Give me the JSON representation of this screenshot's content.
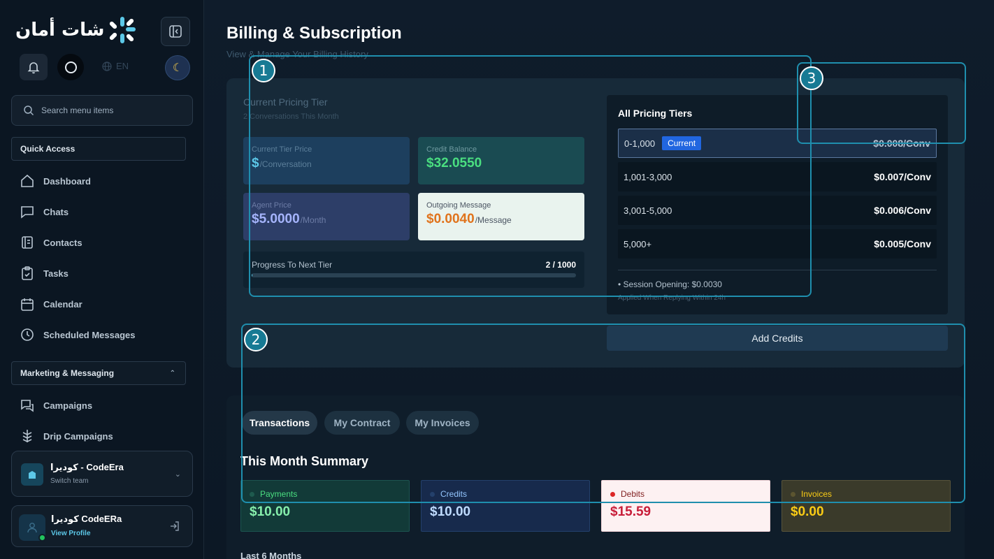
{
  "app": {
    "logo_text": "شات أمان",
    "language": "EN"
  },
  "sidebar": {
    "search_placeholder": "Search menu items",
    "quick_access": "Quick Access",
    "items": [
      {
        "label": "Dashboard",
        "icon": "home-icon"
      },
      {
        "label": "Chats",
        "icon": "chat-icon"
      },
      {
        "label": "Contacts",
        "icon": "contacts-icon"
      },
      {
        "label": "Tasks",
        "icon": "clipboard-icon"
      },
      {
        "label": "Calendar",
        "icon": "calendar-icon"
      },
      {
        "label": "Scheduled Messages",
        "icon": "clock-icon"
      }
    ],
    "marketing_section": "Marketing & Messaging",
    "marketing_items": [
      {
        "label": "Campaigns",
        "icon": "campaigns-icon"
      },
      {
        "label": "Drip Campaigns",
        "icon": "drip-icon"
      }
    ],
    "team": {
      "name": "كوديرا - CodeEra",
      "sub": "Switch team"
    },
    "profile": {
      "name": "كوديرا CodeERa",
      "link": "View Profile"
    }
  },
  "page": {
    "title": "Billing & Subscription",
    "subtitle": "View & Manage Your Billing History"
  },
  "billing": {
    "tier_title": "Current Pricing Tier",
    "tier_sub": "2 Conversations This Month",
    "tier_price": {
      "label": "Current Tier Price",
      "value": "$",
      "unit": "/Conversation"
    },
    "credit_balance": {
      "label": "Credit Balance",
      "value": "$32.0550"
    },
    "agent_price": {
      "label": "Agent Price",
      "value": "$5.0000",
      "unit": "/Month"
    },
    "outgoing": {
      "label": "Outgoing Message",
      "value": "$0.0040",
      "unit": "/Message"
    },
    "progress": {
      "label": "Progress To Next Tier",
      "count": "2 / 1000",
      "fraction": 0.002
    },
    "add_credits": "Add Credits"
  },
  "tiers": {
    "title": "All Pricing Tiers",
    "current_badge": "Current",
    "rows": [
      {
        "range": "0-1,000",
        "price": "$0.008/Conv",
        "current": true
      },
      {
        "range": "1,001-3,000",
        "price": "$0.007/Conv",
        "current": false
      },
      {
        "range": "3,001-5,000",
        "price": "$0.006/Conv",
        "current": false
      },
      {
        "range": "5,000+",
        "price": "$0.005/Conv",
        "current": false
      }
    ],
    "session_line": "• Session Opening: $0.0030",
    "session_note": "Applied When Replying Within 24h"
  },
  "tabs": [
    "Transactions",
    "My Contract",
    "My Invoices"
  ],
  "summary": {
    "title": "This Month Summary",
    "cards": [
      {
        "label": "Payments",
        "value": "$10.00"
      },
      {
        "label": "Credits",
        "value": "$10.00"
      },
      {
        "label": "Debits",
        "value": "$15.59"
      },
      {
        "label": "Invoices",
        "value": "$0.00"
      }
    ],
    "last_months": "Last 6 Months"
  },
  "annotations": [
    "1",
    "2",
    "3"
  ],
  "colors": {
    "accent": "#5cc8e8",
    "annotation": "#1f8fae",
    "credit_green": "#4ade80",
    "agent_purple": "#a5b4fc",
    "outgoing_orange": "#e0731c",
    "debit_red": "#c81e3a",
    "invoice_yellow": "#facc15"
  }
}
